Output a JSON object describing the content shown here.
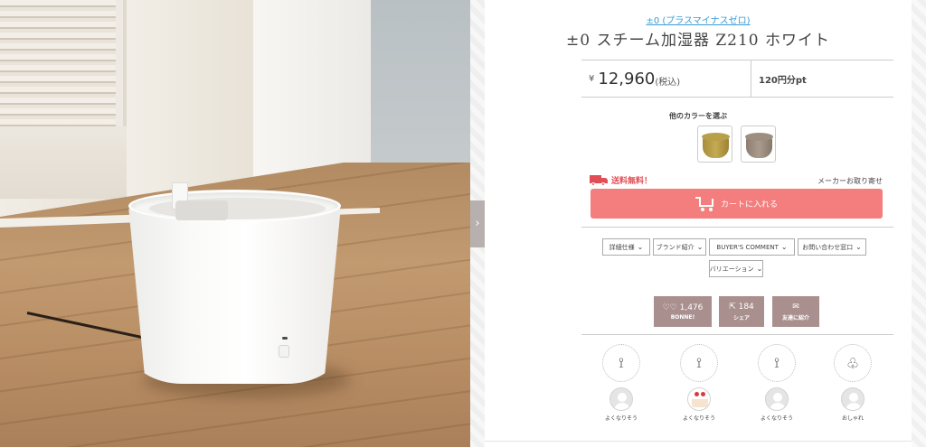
{
  "product": {
    "brand": "±0 (プラスマイナスゼロ)",
    "name": "±0 スチーム加湿器 Z210 ホワイト",
    "price_yen": "¥",
    "price_amount": "12,960",
    "price_tax": "(税込)",
    "points": "120円分pt"
  },
  "colors": {
    "title": "他のカラーを選ぶ",
    "options": [
      "olive",
      "grey"
    ]
  },
  "shipping": {
    "label": "送料無料！",
    "maker_link": "メーカーお取り寄せ"
  },
  "cart": {
    "label": "カートに入れる"
  },
  "tabs": [
    {
      "label": "詳細仕様"
    },
    {
      "label": "ブランド紹介"
    },
    {
      "label": "BUYER'S COMMENT"
    },
    {
      "label": "お問い合わせ窓口"
    },
    {
      "label": "バリエーション"
    }
  ],
  "social": {
    "bonne_count": "1,476",
    "bonne_label": "BONNE!",
    "share_count": "184",
    "share_label": "シェア",
    "friend_label": "友達に紹介"
  },
  "staff": [
    {
      "label": "よくなりそう"
    },
    {
      "label": "よくなりそう"
    },
    {
      "label": "よくなりそう"
    },
    {
      "label": "おしゃれ"
    }
  ],
  "slider": {
    "arrow": "›"
  },
  "colors_hex": {
    "accent": "#f47d7d",
    "shipping": "#e24e55",
    "social": "#a9908f",
    "brand_link": "#3a9bd5"
  }
}
